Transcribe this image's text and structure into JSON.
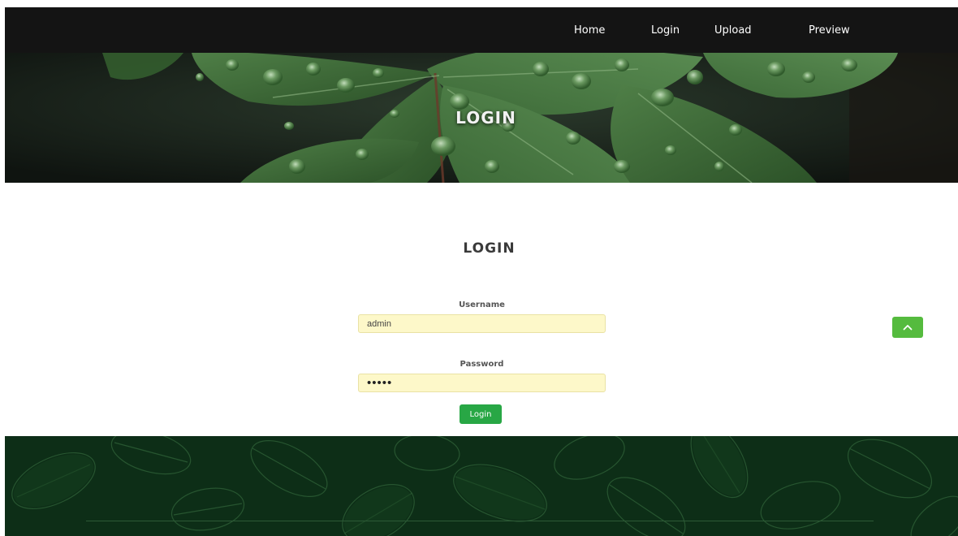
{
  "nav": {
    "items": [
      {
        "label": "Home"
      },
      {
        "label": "Login"
      },
      {
        "label": "Upload"
      },
      {
        "label": "Preview"
      }
    ]
  },
  "hero": {
    "title": "LOGIN"
  },
  "form": {
    "heading": "LOGIN",
    "username_label": "Username",
    "username_value": "admin",
    "password_label": "Password",
    "password_value": "•••••",
    "submit_label": "Login"
  },
  "icons": {
    "scroll_top": "chevron-up-icon"
  },
  "colors": {
    "navbar": "#141414",
    "input_fill": "#fdf8c9",
    "login_button": "#28a745",
    "scroll_top_button": "#55bb3e",
    "footer": "#0d2e17"
  }
}
